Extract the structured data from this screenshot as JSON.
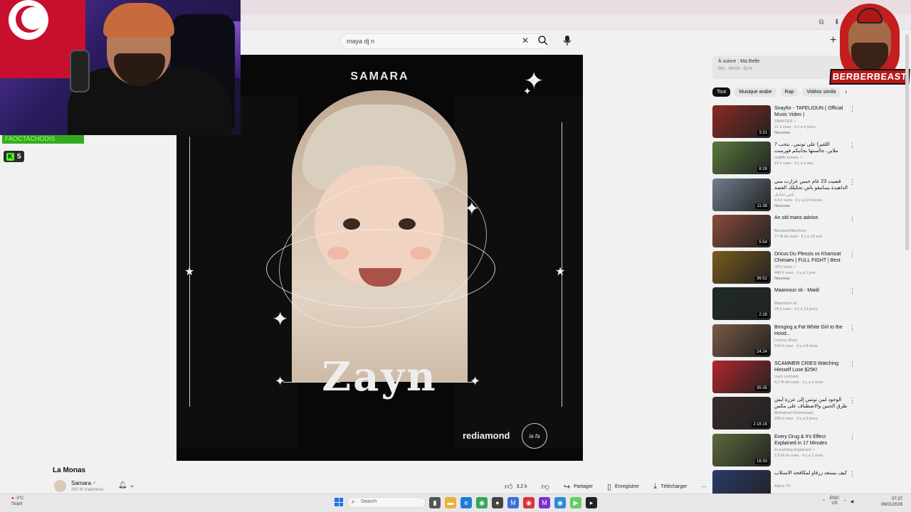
{
  "search": {
    "query": "maya dj n"
  },
  "overlay": {
    "sub_banner": "FAOCTACHODIS",
    "kick_count": "5",
    "kick_icon_label": "K",
    "logo_text": "BERBERBEAST"
  },
  "player": {
    "album_title": "SAMARA",
    "artwork_title": "Zayn",
    "label_logo": "rediamond",
    "seal_text": "la fa"
  },
  "video": {
    "title": "La Monas",
    "channel": "Samara",
    "verified_mark": "✓",
    "subscribers": "330 M d'abonnés",
    "actions": {
      "likes": "3,2 k",
      "share": "Partager",
      "save": "Enregistrer",
      "download": "Télécharger",
      "more": "⋯"
    }
  },
  "sidebar": {
    "up_next_title": "À suivre : Ma Belle",
    "up_next_sub": "Mix · MAYA · Dj N",
    "chips": [
      "Tout",
      "Musique arabe",
      "Rap",
      "Vidéos simila"
    ],
    "recommendations": [
      {
        "title": "Snayfor - TAFELIOUN ( Official Music Video )",
        "channel": "SNAYFER ✓",
        "meta": "21 k vues · il y a 4 jours",
        "badge": "Nouveau",
        "duration": "3:31",
        "color": "#8b2a22"
      },
      {
        "title": "اللقيرا على تونس.. بتحب 7 ملاين..جالستها بجانبكم فورست",
        "channel": "reallife tunisia ✓",
        "meta": "15 k vues · il y a 3 ans",
        "badge": "",
        "duration": "8:28",
        "color": "#5a7a3e"
      },
      {
        "title": "قضيت 23 عام حبس عزارت مني الداهيدة يسانيقو ياش نحكيلك القصة باش تعاون",
        "channel": "يامي تشانيل",
        "meta": "4,4 k vues · il y a 23 heures",
        "badge": "Nouveau",
        "duration": "11:38",
        "color": "#6f7f8f"
      },
      {
        "title": "An old mans advice.",
        "channel": "Bernard Attanhoro",
        "meta": "77 M de vues · il y a 10 ans",
        "badge": "",
        "duration": "5:54",
        "color": "#8a4b3a"
      },
      {
        "title": "Dricus Du Plessis vs Khamzat Chimaev | FULL FIGHT | Best O...",
        "channel": "UFC India ✓",
        "meta": "446 k vues · il y a 1 jour",
        "badge": "Nouveau",
        "duration": "36:52",
        "color": "#7a5b1c"
      },
      {
        "title": "Maamoun sk - Maidi",
        "channel": "Maamoun sk",
        "meta": "29 k vues · il y a 13 jours",
        "badge": "",
        "duration": "2:28",
        "color": "#1f2a2a"
      },
      {
        "title": "Bringing a Fat White Girl to the Hood...",
        "channel": "Lonnny Rose",
        "meta": "104 k vues · il y a 8 mois",
        "badge": "",
        "duration": "24:24",
        "color": "#7a5a44"
      },
      {
        "title": "SCAMMER CRIES Watching Himself Lose $25K!",
        "channel": "Liam Lochelin",
        "meta": "4,2 M de vues · il y a 3 mois",
        "badge": "",
        "duration": "35:35",
        "color": "#b3262b"
      },
      {
        "title": "الوجود لمن تونس إلى عزرة أيش طرق الحنين والاضطياف على مكس يمينا",
        "channel": "Mohamed Khammassi",
        "meta": "299 k vues · il y a 3 jours",
        "badge": "",
        "duration": "2:18:15",
        "color": "#3a2a2a"
      },
      {
        "title": "Every Drug & It's Effect Explained in 17 Minutes",
        "channel": "Everything Explained ✓",
        "meta": "2,6 M de vues · il y a 2 mois",
        "badge": "",
        "duration": "16:33",
        "color": "#5c6b3a"
      },
      {
        "title": "كيف يستعد زرقاو لمكافحة الاستلاب",
        "channel": "Alpha TV",
        "meta": "",
        "badge": "",
        "duration": "",
        "color": "#2a3a6a"
      }
    ]
  },
  "taskbar": {
    "weather_temp": "-3°C",
    "weather_desc": "Stupit",
    "search_placeholder": "Search",
    "lang_line1": "ENG",
    "lang_line2": "US",
    "time": "07:37",
    "date": "06/01/2026"
  }
}
